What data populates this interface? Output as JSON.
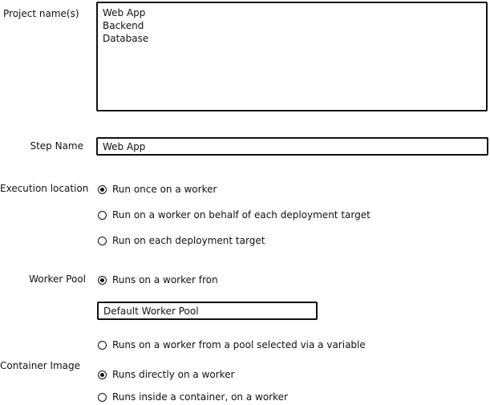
{
  "projects": {
    "label": "Project name(s)",
    "items": [
      "Web App",
      "Backend",
      "Database"
    ]
  },
  "step_name": {
    "label": "Step Name",
    "value": "Web App"
  },
  "execution_location": {
    "label": "Execution location",
    "options": [
      {
        "text": "Run once on a worker",
        "selected": true
      },
      {
        "text": "Run on a worker on behalf of each deployment target",
        "selected": false
      },
      {
        "text": "Run on each deployment target",
        "selected": false
      }
    ]
  },
  "worker_pool": {
    "label": "Worker Pool",
    "option_fixed": {
      "text": "Runs on a worker fron",
      "selected": true
    },
    "pool_value": "Default Worker Pool",
    "option_variable": {
      "text": "Runs on a worker from a pool selected via a variable",
      "selected": false
    }
  },
  "container_image": {
    "label": "Container Image",
    "options": [
      {
        "text": "Runs directly on a worker",
        "selected": true
      },
      {
        "text": "Runs inside a container, on a worker",
        "selected": false
      }
    ]
  }
}
